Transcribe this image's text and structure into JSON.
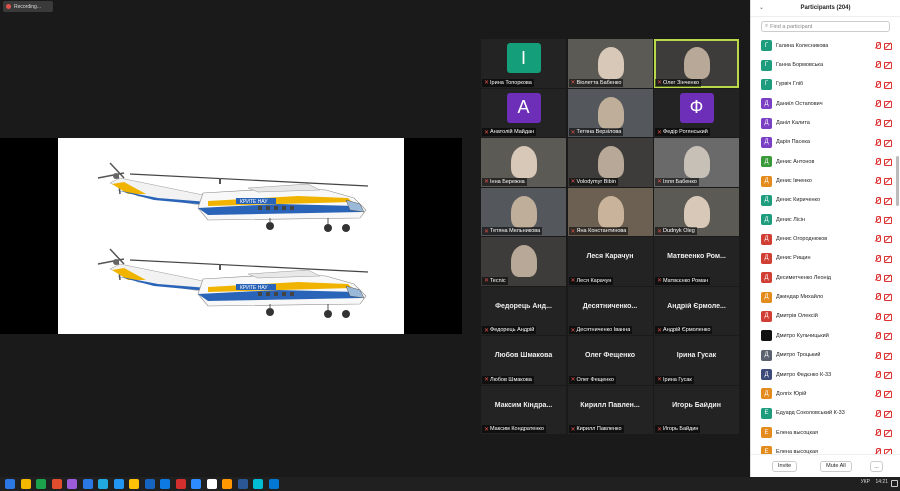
{
  "recording": {
    "label": "Recording..."
  },
  "participants_panel": {
    "title": "Participants (204)",
    "search_placeholder": "Find a participant",
    "invite_label": "Invite",
    "mute_all_label": "Mute All",
    "more_label": "...",
    "list": [
      {
        "initial": "Г",
        "name": "Галина Колесникова",
        "color": "#1d9c7e"
      },
      {
        "initial": "Г",
        "name": "Ганна Бормовська",
        "color": "#1d9c7e"
      },
      {
        "initial": "Г",
        "name": "Гурвіч Гліб",
        "color": "#1d9c7e"
      },
      {
        "initial": "Д",
        "name": "Даниїл Остапович",
        "color": "#7b3fc4"
      },
      {
        "initial": "Д",
        "name": "Даніл Калита",
        "color": "#7b3fc4"
      },
      {
        "initial": "Д",
        "name": "Дарія Пасека",
        "color": "#7b3fc4"
      },
      {
        "initial": "Д",
        "name": "Денис Антонов",
        "color": "#3a9a3a"
      },
      {
        "initial": "Д",
        "name": "Денис Івченко",
        "color": "#e38b1c"
      },
      {
        "initial": "Д",
        "name": "Денис Кириченко",
        "color": "#1d9c7e"
      },
      {
        "initial": "Д",
        "name": "Денис Лісін",
        "color": "#1d9c7e"
      },
      {
        "initial": "Д",
        "name": "Денис Огороднюков",
        "color": "#d13f34"
      },
      {
        "initial": "Д",
        "name": "Денис Рищин",
        "color": "#d13f34"
      },
      {
        "initial": "Д",
        "name": "Десиметченко Леонід",
        "color": "#d13f34"
      },
      {
        "initial": "Д",
        "name": "Джиндар Михайло",
        "color": "#e38b1c"
      },
      {
        "initial": "Д",
        "name": "Дмитрів Олексій",
        "color": "#d13f34"
      },
      {
        "initial": "",
        "name": "Дмитро Кульчицький",
        "color": "#111111"
      },
      {
        "initial": "Д",
        "name": "Дмитро Троцький",
        "color": "#5a6270"
      },
      {
        "initial": "Д",
        "name": "Дмитро Федєнко К-33",
        "color": "#3c4a7a"
      },
      {
        "initial": "Д",
        "name": "Долгіх Юрій",
        "color": "#e38b1c"
      },
      {
        "initial": "Е",
        "name": "Едуард Соколовський К-33",
        "color": "#1d9c7e"
      },
      {
        "initial": "Е",
        "name": "Елена высоцкая",
        "color": "#e38b1c"
      },
      {
        "initial": "Е",
        "name": "Елена высоцкая",
        "color": "#e38b1c"
      }
    ]
  },
  "video_tiles": [
    {
      "name": "Ірина Топоркова",
      "avatar_letter": "І",
      "avatar_color": "#159e7a"
    },
    {
      "name": "Віолетта Бабенко",
      "photo": true
    },
    {
      "name": "Олег Зінченко",
      "photo": true,
      "active": true
    },
    {
      "name": "Анатолій Майдан",
      "avatar_letter": "А",
      "avatar_color": "#6d2fb8"
    },
    {
      "name": "Тетяна Верзілова",
      "photo": true
    },
    {
      "name": "Федір Рогянський",
      "avatar_letter": "Ф",
      "avatar_color": "#6d2fb8"
    },
    {
      "name": "Інна Бережна",
      "photo": true
    },
    {
      "name": "Volodymyr Bibin",
      "photo": true
    },
    {
      "name": "Ілля Бабенко",
      "photo": true
    },
    {
      "name": "Тетяна Мельникова",
      "photo": true
    },
    {
      "name": "Яна Константинова",
      "photo": true
    },
    {
      "name": "Dudnyk Oleg",
      "photo": true
    },
    {
      "name": "Tecnic",
      "photo": true
    },
    {
      "name": "Леся Карачун",
      "big": "Леся Карачун"
    },
    {
      "name": "Матвєєнко Роман",
      "big": "Матвеенко Ром..."
    },
    {
      "name": "Федорець Андрій",
      "big": "Федорець Анд..."
    },
    {
      "name": "Десятниченко Іванна",
      "big": "Десятниченко..."
    },
    {
      "name": "Андрій Єрмоленко",
      "big": "Андрій Єрмоле..."
    },
    {
      "name": "Любов Шмакова",
      "big": "Любов Шмакова"
    },
    {
      "name": "Олег Фещенко",
      "big": "Олег Фещенко"
    },
    {
      "name": "Ірина Гусак",
      "big": "Ірина Гусак"
    },
    {
      "name": "Максим Кондратенко",
      "big": "Максим Кіндра..."
    },
    {
      "name": "Кирилл Павленко",
      "big": "Кирилл Павлен..."
    },
    {
      "name": "Игорь Байдин",
      "big": "Игорь Байдин"
    }
  ],
  "taskbar": {
    "language": "УКР",
    "time": "14:21",
    "app_colors": [
      "#2b78e4",
      "#f5b800",
      "#1aa34a",
      "#e24d2e",
      "#9c5bd8",
      "#2b78e4",
      "#21a8e0",
      "#2196f3",
      "#ffc107",
      "#1565c0",
      "#0d7ae3",
      "#d32f2f",
      "#2d8cff",
      "#ffffff",
      "#ff9800",
      "#2b5797",
      "#00bcd4",
      "#0078d4"
    ]
  }
}
